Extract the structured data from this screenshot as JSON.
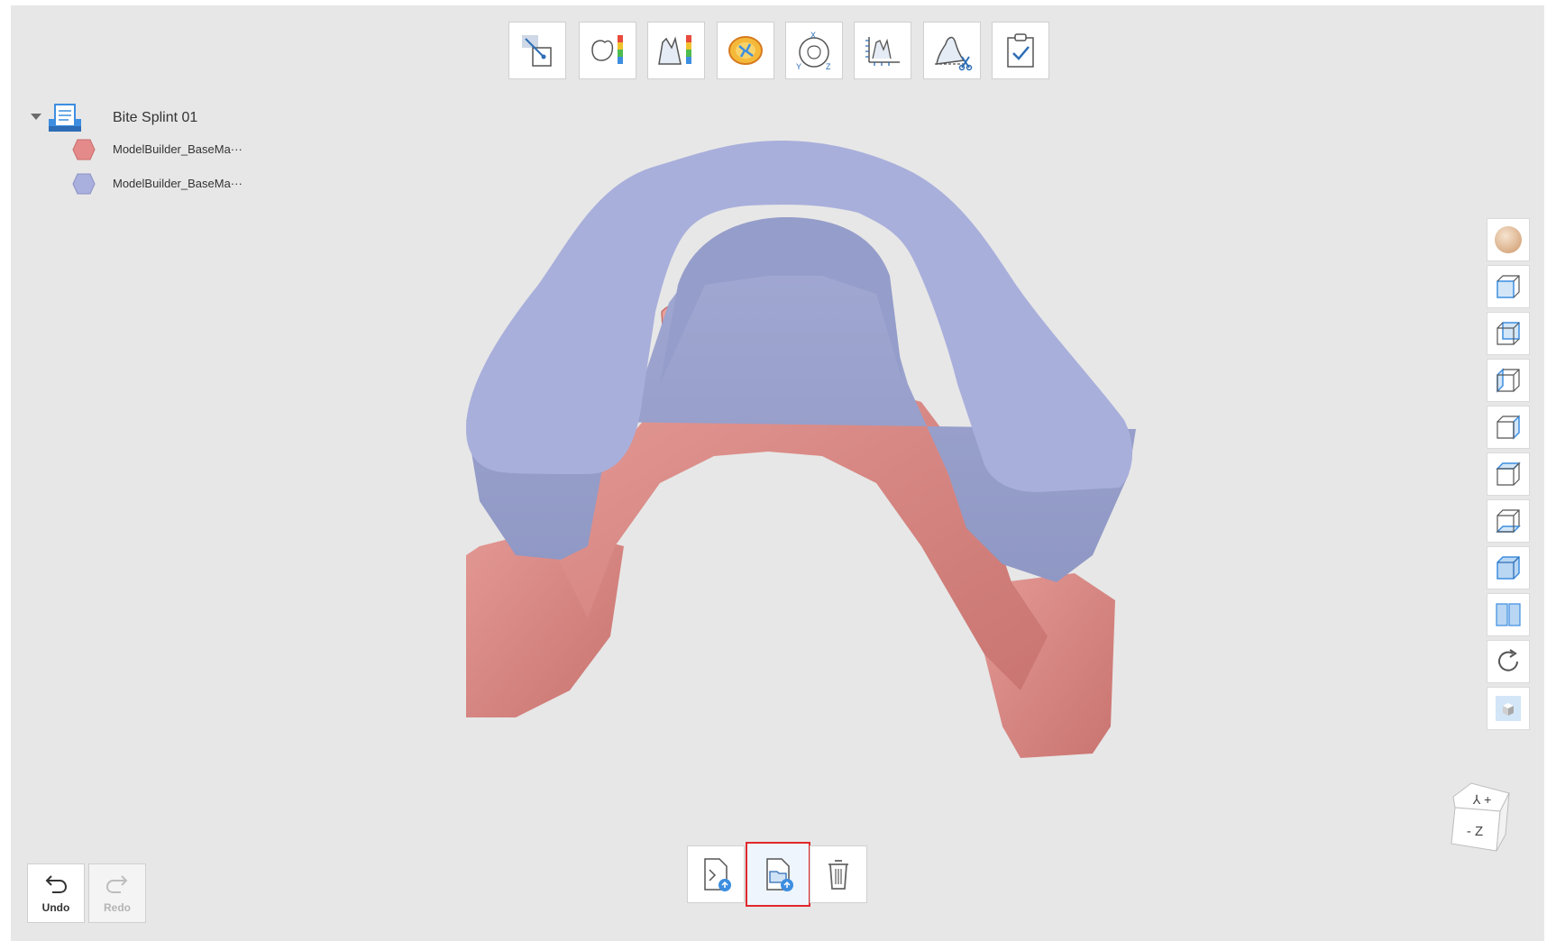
{
  "project_tree": {
    "root_label": "Bite Splint 01",
    "items": [
      {
        "label": "ModelBuilder_BaseMa···",
        "color": "#e58a8a"
      },
      {
        "label": "ModelBuilder_BaseMa···",
        "color": "#aab0de"
      }
    ]
  },
  "top_toolbar": {
    "icons": [
      "select-tool-icon",
      "tooth-color-map-icon",
      "deviation-map-icon",
      "occlusion-map-icon",
      "xyz-orientation-icon",
      "measure-icon",
      "clip-section-icon",
      "task-complete-icon"
    ]
  },
  "right_toolbar": {
    "icons": [
      "material-sphere-icon",
      "view-front-icon",
      "view-back-icon",
      "view-left-icon",
      "view-right-icon",
      "view-top-icon",
      "view-bottom-icon",
      "view-iso-icon",
      "split-view-icon",
      "reset-rotation-icon",
      "solid-box-icon"
    ]
  },
  "bottom_toolbar": {
    "icons": [
      "export-file-icon",
      "open-folder-icon",
      "trash-icon"
    ],
    "active_index": 1
  },
  "history": {
    "undo_label": "Undo",
    "redo_label": "Redo"
  },
  "orientation_cube": {
    "top_face": "⅄ +",
    "front_face": "- Z"
  },
  "colors": {
    "splint": "#a8aed6",
    "gingiva": "#d98683",
    "highlight_border": "#e0282c",
    "accent": "#3d8ee0"
  }
}
